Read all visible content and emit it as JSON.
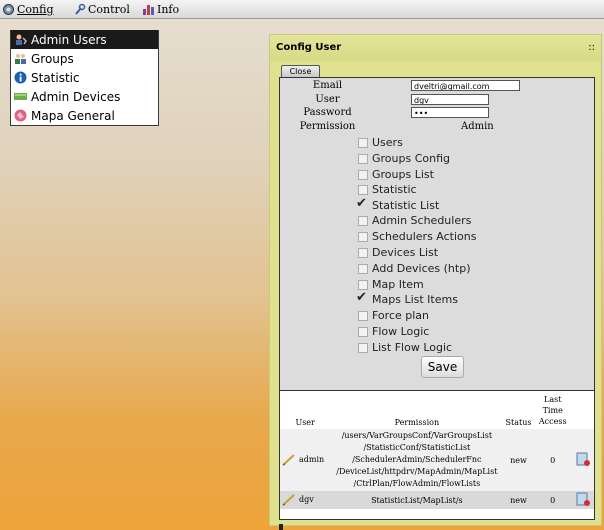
{
  "menubar": {
    "items": [
      {
        "label": "Config",
        "icon": "gear-icon"
      },
      {
        "label": "Control",
        "icon": "wrench-icon"
      },
      {
        "label": "Info",
        "icon": "chart-icon"
      }
    ]
  },
  "dropdown": {
    "items": [
      {
        "label": "Admin Users",
        "icon": "user-admin-icon",
        "active": true
      },
      {
        "label": "Groups",
        "icon": "groups-icon",
        "active": false
      },
      {
        "label": "Statistic",
        "icon": "info-circle-icon",
        "active": false
      },
      {
        "label": "Admin Devices",
        "icon": "devices-icon",
        "active": false
      },
      {
        "label": "Mapa General",
        "icon": "map-icon",
        "active": false
      }
    ]
  },
  "panel": {
    "title": "Config User",
    "grip": "::",
    "close_label": "Close",
    "form": {
      "email_label": "Email",
      "email_value": "dveltri@gmail.com",
      "user_label": "User",
      "user_value": "dgv",
      "password_label": "Password",
      "password_value": "•••",
      "permission_label": "Permission",
      "permission_value": "Admin",
      "save_label": "Save"
    },
    "permissions": [
      {
        "label": "Users",
        "checked": false
      },
      {
        "label": "Groups Config",
        "checked": false
      },
      {
        "label": "Groups List",
        "checked": false
      },
      {
        "label": "Statistic",
        "checked": false
      },
      {
        "label": "Statistic List",
        "checked": true
      },
      {
        "label": "Admin Schedulers",
        "checked": false
      },
      {
        "label": "Schedulers Actions",
        "checked": false
      },
      {
        "label": "Devices List",
        "checked": false
      },
      {
        "label": "Add Devices (htp)",
        "checked": false
      },
      {
        "label": "Map Item",
        "checked": false
      },
      {
        "label": "Maps List Items",
        "checked": true
      },
      {
        "label": "Force plan",
        "checked": false
      },
      {
        "label": "Flow Logic",
        "checked": false
      },
      {
        "label": "List Flow Logic",
        "checked": false
      }
    ],
    "table": {
      "headers": {
        "user": "User",
        "permission": "Permission",
        "status": "Status",
        "last_time_access_1": "Last",
        "last_time_access_2": "Time",
        "last_time_access_3": "Access"
      },
      "rows": [
        {
          "user": "admin",
          "permission_lines": [
            "/users/VarGroupsConf/VarGroupsList",
            "/StatisticConf/StatisticList",
            "/SchedulerAdmin/SchedulerFnc",
            "/DeviceList/httpdrv/MapAdmin/MapList",
            "/CtrlPlan/FlowAdmin/FlowLists"
          ],
          "status": "new",
          "last_access": "0"
        },
        {
          "user": "dgv",
          "permission_lines": [
            "StatisticList/MapList/s"
          ],
          "status": "new",
          "last_access": "0"
        }
      ]
    }
  },
  "colors": {
    "panel_bg": "#dfe18f",
    "active_menu_bg": "#1a1a1a",
    "form_bg": "#dcdcdc"
  }
}
